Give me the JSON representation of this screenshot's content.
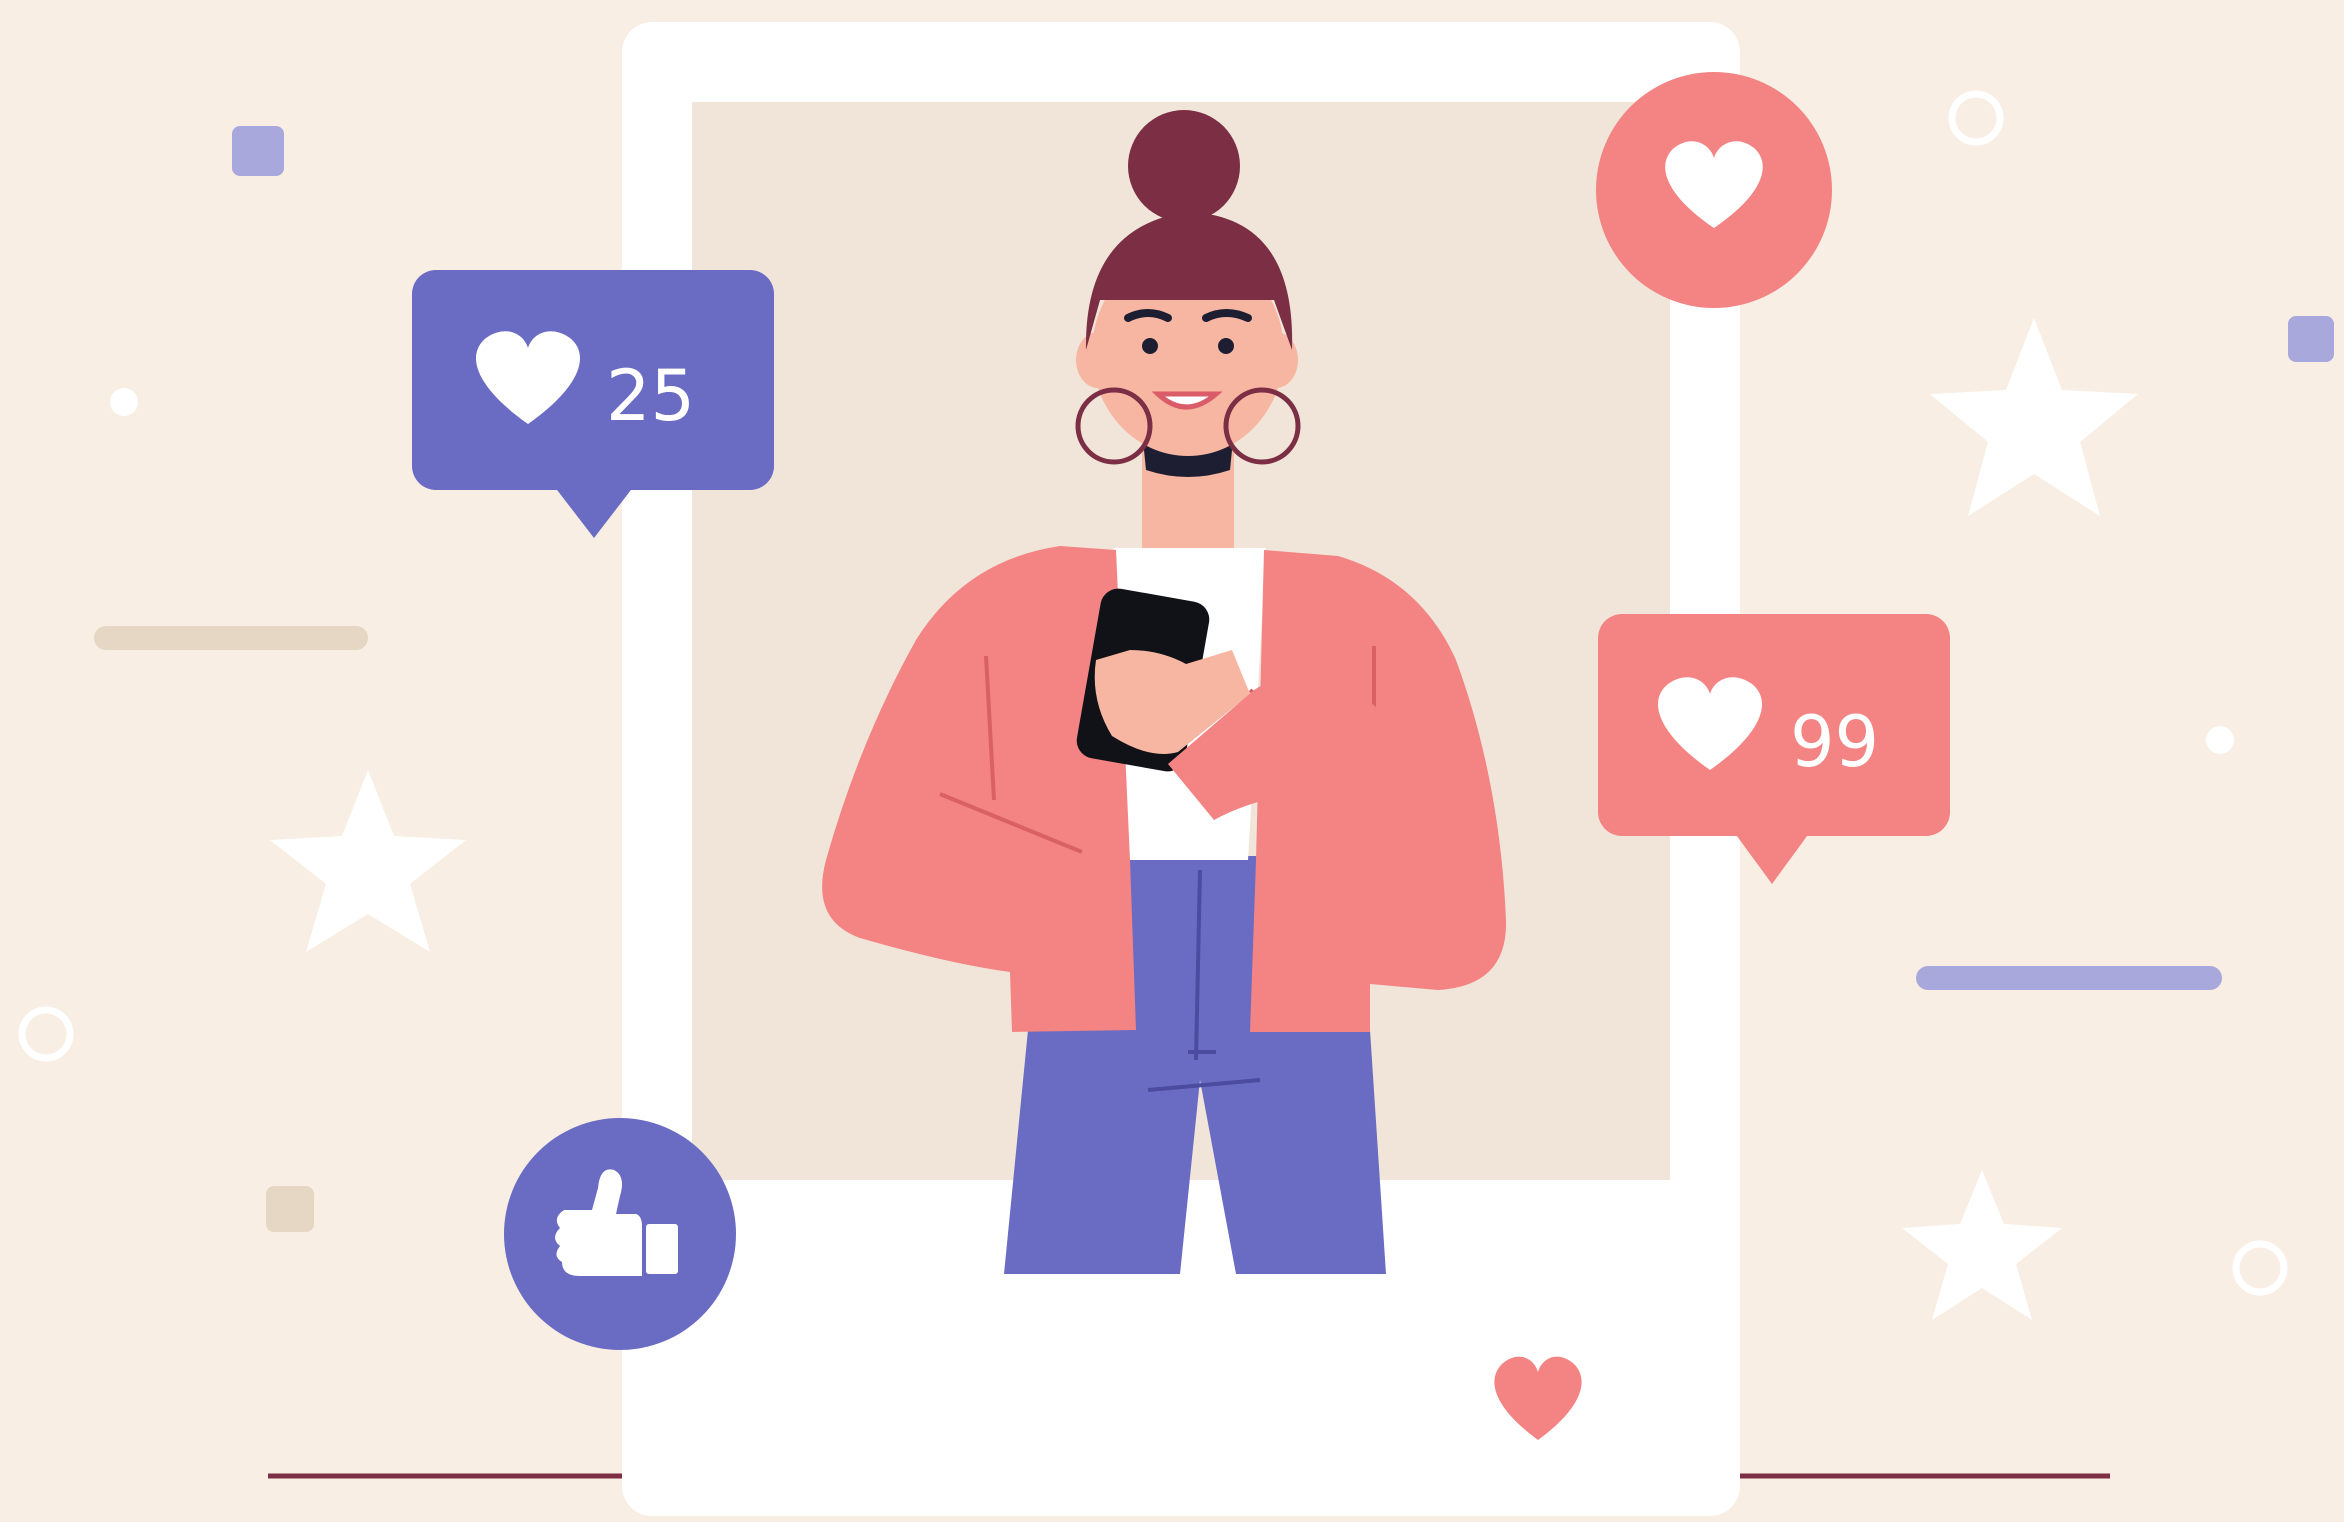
{
  "scene": {
    "purple_like_counter": {
      "count": "25",
      "icon": "heart-icon"
    },
    "coral_like_counter": {
      "count": "99",
      "icon": "heart-icon"
    },
    "heart_reaction_badge": {
      "icon": "heart-icon"
    },
    "thumbs_up_badge": {
      "icon": "thumbs-up-icon"
    },
    "photo_heart": {
      "icon": "heart-icon"
    }
  },
  "colors": {
    "background": "#f8eee3",
    "photo_backdrop": "#f1e5da",
    "frame": "#ffffff",
    "purple": "#6a6bc3",
    "coral": "#f38483",
    "hair": "#7b2e44",
    "skin": "#f7b6a1",
    "jacket": "#f38483",
    "pants": "#6a6bc3",
    "lavender_accent": "#a9a8dc",
    "beige_accent": "#e6d6c4",
    "ground_line": "#7b2e44"
  }
}
